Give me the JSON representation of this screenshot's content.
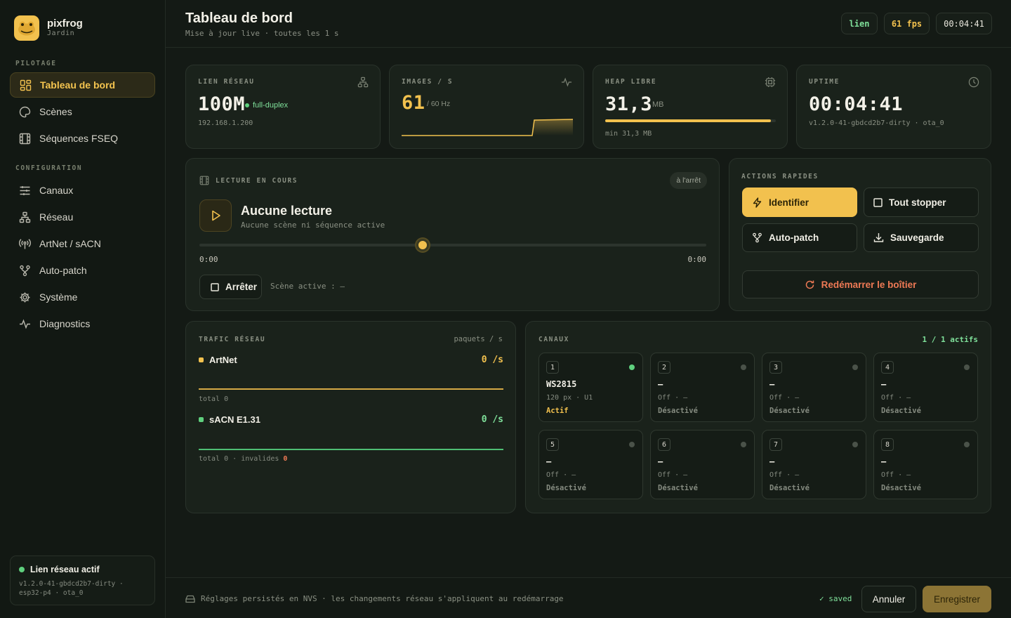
{
  "brand": {
    "name": "pixfrog",
    "sub": "Jardin"
  },
  "sidebar": {
    "section_pilotage": "PILOTAGE",
    "section_config": "CONFIGURATION",
    "items": [
      {
        "label": "Tableau de bord",
        "icon": "dashboard-icon"
      },
      {
        "label": "Scènes",
        "icon": "palette-icon"
      },
      {
        "label": "Séquences FSEQ",
        "icon": "film-icon"
      },
      {
        "label": "Canaux",
        "icon": "sliders-icon"
      },
      {
        "label": "Réseau",
        "icon": "network-icon"
      },
      {
        "label": "ArtNet / sACN",
        "icon": "broadcast-icon"
      },
      {
        "label": "Auto-patch",
        "icon": "branch-icon"
      },
      {
        "label": "Système",
        "icon": "gear-icon"
      },
      {
        "label": "Diagnostics",
        "icon": "pulse-icon"
      }
    ],
    "link": {
      "title": "Lien réseau actif",
      "meta1": "v1.2.0-41-gbdcd2b7-dirty ·",
      "meta2": "esp32-p4 · ota_0"
    }
  },
  "header": {
    "title": "Tableau de bord",
    "subtitle": "Mise à jour live · toutes les 1 s",
    "pills": {
      "link": "lien",
      "fps": "61 fps",
      "time": "00:04:41"
    }
  },
  "stats": {
    "network": {
      "label": "LIEN RÉSEAU",
      "value": "100M",
      "duplex": "full-duplex",
      "ip": "192.168.1.200"
    },
    "images": {
      "label": "IMAGES / S",
      "value": "61",
      "unit": "/ 60 Hz"
    },
    "heap": {
      "label": "HEAP LIBRE",
      "value": "31,3",
      "unit": "MB",
      "min": "min 31,3 MB",
      "level": 0.97
    },
    "uptime": {
      "label": "UPTIME",
      "value": "00:04:41",
      "version": "v1.2.0-41-gbdcd2b7-dirty · ota_0"
    }
  },
  "playback": {
    "label": "LECTURE EN COURS",
    "state": "à l'arrêt",
    "title": "Aucune lecture",
    "subtitle": "Aucune scène ni séquence active",
    "time_start": "0:00",
    "time_end": "0:00",
    "stop_label": "Arrêter",
    "active_scene": "Scène active : —"
  },
  "actions": {
    "label": "ACTIONS RAPIDES",
    "identify": "Identifier",
    "stop_all": "Tout stopper",
    "autopatch": "Auto-patch",
    "save": "Sauvegarde",
    "restart": "Redémarrer le boîtier"
  },
  "traffic": {
    "label": "TRAFIC RÉSEAU",
    "unit": "paquets / s",
    "artnet": {
      "name": "ArtNet",
      "rate": "0 /s",
      "total": "total 0"
    },
    "sacn": {
      "name": "sACN E1.31",
      "rate": "0 /s",
      "total": "total 0 · invalides",
      "invalid": "0"
    }
  },
  "channels": {
    "label": "CANAUX",
    "active_count": "1 / 1 actifs",
    "items": [
      {
        "num": "1",
        "name": "WS2815",
        "meta": "120 px · U1",
        "status": "Actif",
        "on": true
      },
      {
        "num": "2",
        "name": "—",
        "meta": "Off · —",
        "status": "Désactivé",
        "on": false
      },
      {
        "num": "3",
        "name": "—",
        "meta": "Off · —",
        "status": "Désactivé",
        "on": false
      },
      {
        "num": "4",
        "name": "—",
        "meta": "Off · —",
        "status": "Désactivé",
        "on": false
      },
      {
        "num": "5",
        "name": "—",
        "meta": "Off · —",
        "status": "Désactivé",
        "on": false
      },
      {
        "num": "6",
        "name": "—",
        "meta": "Off · —",
        "status": "Désactivé",
        "on": false
      },
      {
        "num": "7",
        "name": "—",
        "meta": "Off · —",
        "status": "Désactivé",
        "on": false
      },
      {
        "num": "8",
        "name": "—",
        "meta": "Off · —",
        "status": "Désactivé",
        "on": false
      }
    ]
  },
  "footer": {
    "note": "Réglages persistés en NVS · les changements réseau s'appliquent au redémarrage",
    "saved": "✓ saved",
    "cancel": "Annuler",
    "save": "Enregistrer"
  },
  "colors": {
    "accent": "#f2c14e",
    "green": "#5fd07e",
    "danger": "#ef7a55"
  }
}
